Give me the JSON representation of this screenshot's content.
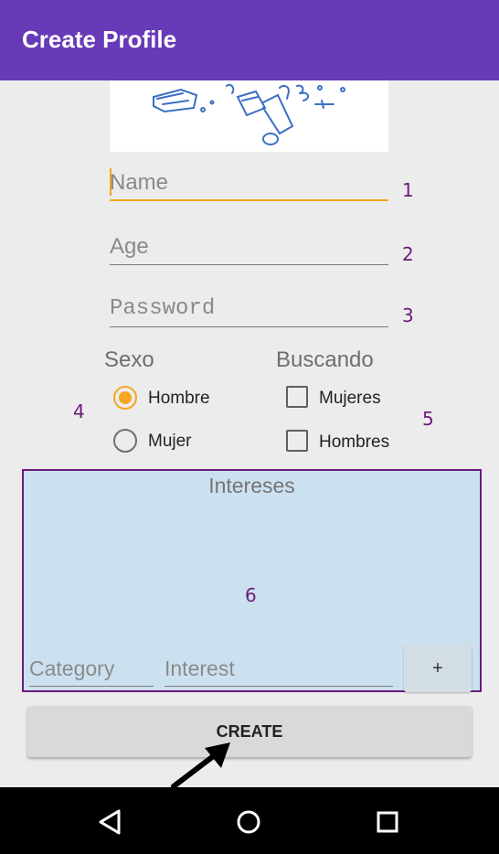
{
  "app": {
    "title": "Create Profile"
  },
  "form": {
    "name_placeholder": "Name",
    "age_placeholder": "Age",
    "password_placeholder": "Password"
  },
  "sexo": {
    "label": "Sexo",
    "options": [
      {
        "label": "Hombre",
        "selected": true
      },
      {
        "label": "Mujer",
        "selected": false
      }
    ]
  },
  "buscando": {
    "label": "Buscando",
    "options": [
      {
        "label": "Mujeres",
        "checked": false
      },
      {
        "label": "Hombres",
        "checked": false
      }
    ]
  },
  "interests": {
    "title": "Intereses",
    "category_placeholder": "Category",
    "interest_placeholder": "Interest",
    "add_label": "+"
  },
  "create_button": {
    "label": "CREATE"
  },
  "annotations": [
    "1",
    "2",
    "3",
    "4",
    "5",
    "6"
  ],
  "nav": [
    "back-icon",
    "home-icon",
    "recents-icon"
  ],
  "colors": {
    "appbar": "#673ab7",
    "accent": "#f5a623",
    "annotation": "#6a1b7a",
    "interests_bg": "#cce1f0"
  }
}
